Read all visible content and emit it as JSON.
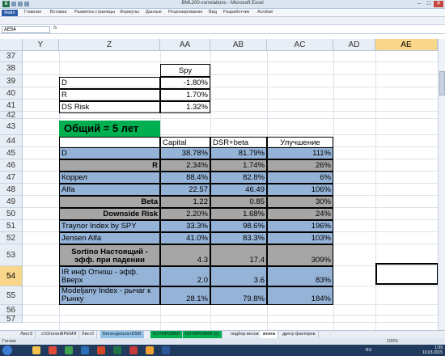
{
  "window": {
    "title": "BML200-correlations - Microsoft Excel",
    "app_icon": "excel-logo-icon",
    "minimize": "‒",
    "maximize": "□",
    "close": "✕"
  },
  "ribbon": {
    "tabs": [
      "Файл",
      "Главная",
      "Вставка",
      "Разметка страницы",
      "Формулы",
      "Данные",
      "Рецензирование",
      "Вид",
      "Разработчик",
      "Acrobat"
    ]
  },
  "formula_bar": {
    "name_box": "AE54",
    "fx": "fx",
    "value": ""
  },
  "columns": [
    "Y",
    "Z",
    "AA",
    "AB",
    "AC",
    "AD",
    "AE"
  ],
  "selected_column": "AE",
  "rows": [
    "37",
    "38",
    "39",
    "40",
    "41",
    "42",
    "43",
    "44",
    "45",
    "46",
    "47",
    "48",
    "49",
    "50",
    "51",
    "52",
    "53",
    "54",
    "55",
    "56",
    "57"
  ],
  "selected_row": "54",
  "small_table": {
    "header": "Spy",
    "rows": [
      {
        "label": "D",
        "value": "-1.80%"
      },
      {
        "label": "R",
        "value": "1.70%"
      },
      {
        "label": "DS Risk",
        "value": "1.32%"
      }
    ]
  },
  "banner": "Общий = 5 лет",
  "main_table": {
    "headers": [
      "Capital",
      "DSR+beta",
      "Улучшение"
    ],
    "rows": [
      {
        "label": "D",
        "v1": "38.78%",
        "v2": "81.79%",
        "v3": "111%",
        "style": "blue",
        "align": "left",
        "bold": false
      },
      {
        "label": "R",
        "v1": "2.34%",
        "v2": "1.74%",
        "v3": "26%",
        "style": "gray",
        "align": "right",
        "bold": true
      },
      {
        "label": "Коррел",
        "v1": "88.4%",
        "v2": "82.8%",
        "v3": "6%",
        "style": "blue",
        "align": "left",
        "bold": false
      },
      {
        "label": "Alfa",
        "v1": "22.57",
        "v2": "46.49",
        "v3": "106%",
        "style": "blue",
        "align": "left",
        "bold": false
      },
      {
        "label": "Beta",
        "v1": "1.22",
        "v2": "0.85",
        "v3": "30%",
        "style": "gray",
        "align": "right",
        "bold": true
      },
      {
        "label": "Downside Risk",
        "v1": "2.20%",
        "v2": "1.68%",
        "v3": "24%",
        "style": "gray",
        "align": "right",
        "bold": true
      },
      {
        "label": "Traynor Index by SPY",
        "v1": "33.3%",
        "v2": "98.6%",
        "v3": "196%",
        "style": "blue",
        "align": "left",
        "bold": false
      },
      {
        "label": "Jensen Alfa",
        "v1": "41.0%",
        "v2": "83.3%",
        "v3": "103%",
        "style": "blue",
        "align": "left",
        "bold": false
      },
      {
        "label": "Sortino Настоящий - эфф. при падении",
        "v1": "4.3",
        "v2": "17.4",
        "v3": "309%",
        "style": "gray",
        "align": "center",
        "bold": true
      },
      {
        "label": "IR инф Отнош - эфф. Вверх",
        "v1": "2.0",
        "v2": "3.6",
        "v3": "83%",
        "style": "blue",
        "align": "left",
        "bold": false
      },
      {
        "label": "Modeljany Index - рычаг к Рынку",
        "v1": "28.1%",
        "v2": "79.8%",
        "v3": "184%",
        "style": "blue",
        "align": "left",
        "bold": false
      }
    ]
  },
  "sheet_tabs": [
    "Лист3",
    "стОтклонВРЕМЯ",
    "Лист2",
    "Бета+дельта+DSR",
    "КОТИРОВКИ",
    "КОТИРОВКИ (2)",
    "подбор весов",
    "итоги",
    "дрегр факторов"
  ],
  "active_sheet": "итоги",
  "status": {
    "ready": "Готово",
    "zoom": "100%"
  },
  "taskbar": {
    "lang": "RU",
    "time": "1:59",
    "date": "19.03.2015"
  },
  "colors": {
    "blue_fill": "#95b3d7",
    "gray_fill": "#a6a6a6",
    "green_fill": "#00b050",
    "selection": "#f8d68a"
  }
}
